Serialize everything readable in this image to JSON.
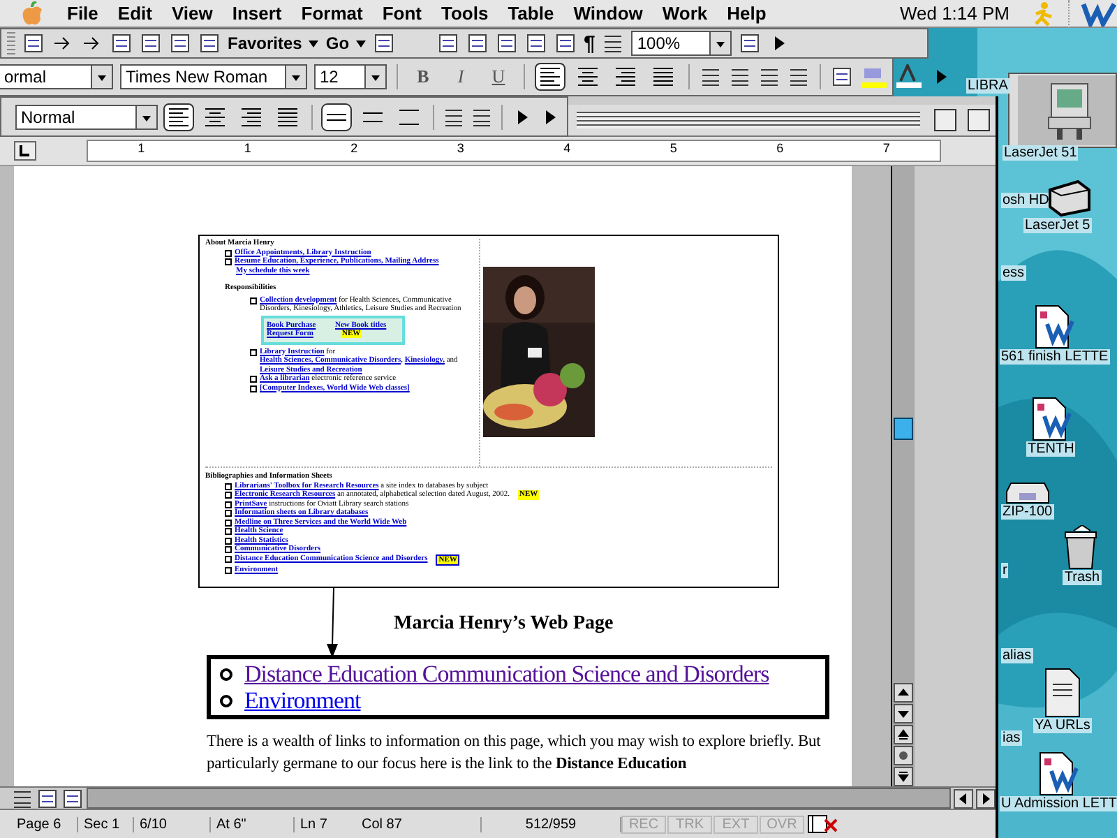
{
  "menu_bar": {
    "menus": [
      "File",
      "Edit",
      "View",
      "Insert",
      "Format",
      "Font",
      "Tools",
      "Table",
      "Window",
      "Work",
      "Help"
    ],
    "clock": "Wed 1:14 PM"
  },
  "browser_toolbar": {
    "favorites": "Favorites",
    "go": "Go"
  },
  "standard_toolbar": {
    "pilcrow": "¶",
    "zoom": "100%"
  },
  "formatting_toolbar": {
    "style": "ormal",
    "font": "Times New Roman",
    "size": "12",
    "bold": "B",
    "italic": "I",
    "underline": "U",
    "alignment": [
      {
        "kind": "left",
        "selected": true
      },
      {
        "kind": "center",
        "selected": false
      },
      {
        "kind": "right",
        "selected": false
      },
      {
        "kind": "justify",
        "selected": false
      }
    ]
  },
  "paragraph_toolbar": {
    "style": "Normal",
    "alignment": [
      {
        "kind": "left",
        "selected": true
      },
      {
        "kind": "center",
        "selected": false
      },
      {
        "kind": "right",
        "selected": false
      },
      {
        "kind": "justify",
        "selected": false
      }
    ],
    "spacing": [
      {
        "kind": "single",
        "selected": true
      },
      {
        "kind": "half",
        "selected": false
      },
      {
        "kind": "double",
        "selected": false
      }
    ]
  },
  "ruler": {
    "ticks": [
      "1",
      "1",
      "2",
      "3",
      "4",
      "5",
      "6",
      "7"
    ]
  },
  "document": {
    "embedded_page": {
      "heading": "About Marcia Henry",
      "top_links": [
        "Office Appointments, Library Instruction",
        "Resume Education, Experience, Publications, Mailing Address"
      ],
      "schedule_link": "My schedule this week",
      "responsibilities_heading": "Responsibilities",
      "responsibilities": [
        {
          "parts": [
            {
              "text": "Collection development",
              "link": true
            },
            {
              "text": " for Health Sciences, Communicative Disorders, Kinesiology, Athletics, Leisure Studies and Recreation",
              "link": false
            }
          ]
        },
        {
          "parts": [
            {
              "text": "Library Instruction",
              "link": true
            },
            {
              "text": " for ",
              "link": false
            },
            {
              "text": "Health Sciences, Communicative Disorders",
              "link": true
            },
            {
              "text": ", ",
              "link": false
            },
            {
              "text": "Kinesiology,",
              "link": true
            },
            {
              "text": " and ",
              "link": false
            },
            {
              "text": "Leisure Studies and Recreation",
              "link": true
            }
          ]
        },
        {
          "parts": [
            {
              "text": "Ask a librarian",
              "link": true
            },
            {
              "text": " electronic reference service",
              "link": false
            }
          ]
        },
        {
          "parts": [
            {
              "text": "[Computer Indexes, World Wide Web classes]",
              "link": true
            }
          ]
        }
      ],
      "table_cells": [
        "Book Purchase Request Form",
        "New Book titles"
      ],
      "new_badge": "NEW",
      "bibliographies_heading": "Bibliographies and Information Sheets",
      "bibliographies": [
        {
          "parts": [
            {
              "text": "Librarians' Toolbox for Research Resources",
              "link": true
            },
            {
              "text": " a site index to databases by subject",
              "link": false
            }
          ]
        },
        {
          "parts": [
            {
              "text": "Electronic Research Resources",
              "link": true
            },
            {
              "text": " an annotated, alphabetical selection dated August, 2002.",
              "link": false
            }
          ],
          "badge": "NEW"
        },
        {
          "parts": [
            {
              "text": "PrintSave",
              "link": true
            },
            {
              "text": " instructions for Oviatt Library search stations",
              "link": false
            }
          ]
        },
        {
          "parts": [
            {
              "text": "Information sheets on Library databases",
              "link": true
            }
          ]
        },
        {
          "parts": [
            {
              "text": "Medline on Three Services and the World Wide Web",
              "link": true
            }
          ]
        },
        {
          "parts": [
            {
              "text": "Health Science",
              "link": true
            }
          ]
        },
        {
          "parts": [
            {
              "text": "Health Statistics",
              "link": true
            }
          ]
        },
        {
          "parts": [
            {
              "text": "Communicative Disorders",
              "link": true
            }
          ]
        },
        {
          "parts": [
            {
              "text": "Distance Education Communication Science and Disorders",
              "link": true
            }
          ],
          "badge": "NEW"
        },
        {
          "parts": [
            {
              "text": "Environment",
              "link": true
            }
          ]
        }
      ]
    },
    "caption": "Marcia Henry’s Web Page",
    "zoomed_links": [
      {
        "text": "Distance Education Communication Science and Disorders",
        "visited": true
      },
      {
        "text": "Environment",
        "visited": false
      }
    ],
    "paragraph": "There is a wealth of links to information on this page, which you may wish to explore briefly.  But particularly germane to our focus here is the link to the **Distance Education**"
  },
  "status_bar": {
    "page": "Page 6",
    "section": "Sec 1",
    "pages": "6/10",
    "at": "At 6\"",
    "line": "Ln 7",
    "column": "Col 87",
    "words": "512/959",
    "modes": [
      {
        "label": "REC",
        "on": false
      },
      {
        "label": "TRK",
        "on": false
      },
      {
        "label": "EXT",
        "on": false
      },
      {
        "label": "OVR",
        "on": false
      }
    ]
  },
  "desktop_icons": [
    {
      "label": "LIBRA",
      "kind": "label"
    },
    {
      "label": "LaserJet 51",
      "kind": "label"
    },
    {
      "label": "osh HD",
      "kind": "label"
    },
    {
      "label": "LaserJet 5",
      "kind": "printer"
    },
    {
      "label": "ess",
      "kind": "label"
    },
    {
      "label": "561 finish LETTE",
      "kind": "document"
    },
    {
      "label": "TENTH",
      "kind": "document"
    },
    {
      "label": "ZIP-100",
      "kind": "zip"
    },
    {
      "label": "Trash",
      "kind": "trash"
    },
    {
      "label": "r",
      "kind": "label"
    },
    {
      "label": "alias",
      "kind": "label"
    },
    {
      "label": "YA URLs",
      "kind": "text"
    },
    {
      "label": "ias",
      "kind": "label"
    },
    {
      "label": "U Admission LETT",
      "kind": "document"
    }
  ]
}
